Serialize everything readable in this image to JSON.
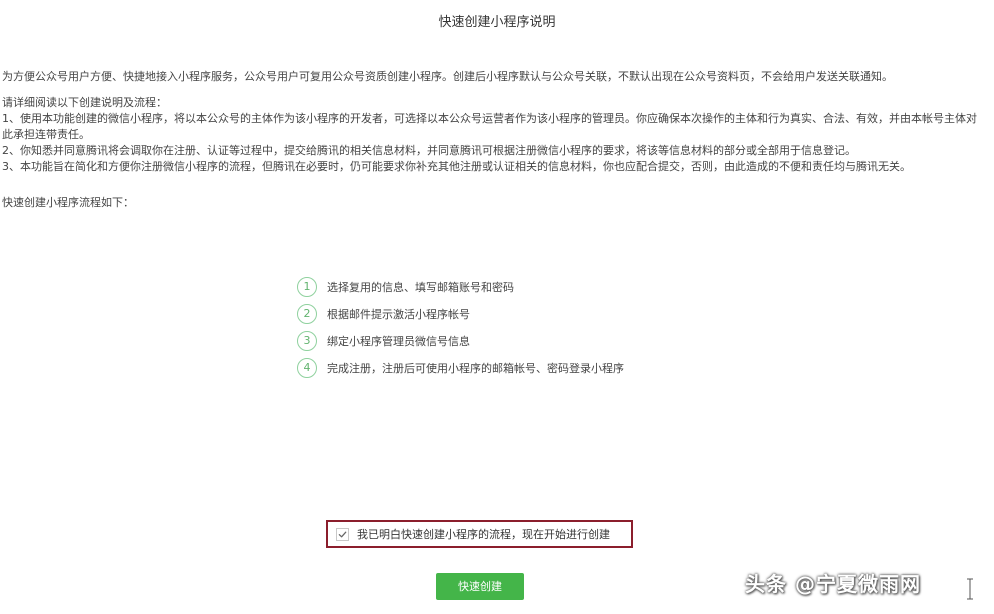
{
  "page": {
    "title": "快速创建小程序说明",
    "intro": "为方便公众号用户方便、快捷地接入小程序服务，公众号用户可复用公众号资质创建小程序。创建后小程序默认与公众号关联，不默认出现在公众号资料页，不会给用户发送关联通知。",
    "instructions_heading": "请详细阅读以下创建说明及流程：",
    "instructions": [
      "1、使用本功能创建的微信小程序，将以本公众号的主体作为该小程序的开发者，可选择以本公众号运营者作为该小程序的管理员。你应确保本次操作的主体和行为真实、合法、有效，并由本帐号主体对此承担连带责任。",
      "2、你知悉并同意腾讯将会调取你在注册、认证等过程中，提交给腾讯的相关信息材料，并同意腾讯可根据注册微信小程序的要求，将该等信息材料的部分或全部用于信息登记。",
      "3、本功能旨在简化和方便你注册微信小程序的流程，但腾讯在必要时，仍可能要求你补充其他注册或认证相关的信息材料，你也应配合提交，否则，由此造成的不便和责任均与腾讯无关。"
    ],
    "process_heading": "快速创建小程序流程如下："
  },
  "steps": [
    {
      "num": "1",
      "text": "选择复用的信息、填写邮箱账号和密码"
    },
    {
      "num": "2",
      "text": "根据邮件提示激活小程序帐号"
    },
    {
      "num": "3",
      "text": "绑定小程序管理员微信号信息"
    },
    {
      "num": "4",
      "text": "完成注册，注册后可使用小程序的邮箱帐号、密码登录小程序"
    }
  ],
  "agreement": {
    "checked": true,
    "label": "我已明白快速创建小程序的流程，现在开始进行创建"
  },
  "actions": {
    "create_label": "快速创建"
  },
  "watermark": {
    "text": "头条 @宁夏微雨网"
  },
  "colors": {
    "accent_green": "#44b549",
    "step_circle": "#8fd19e",
    "highlight_border": "#8b1e2c"
  }
}
